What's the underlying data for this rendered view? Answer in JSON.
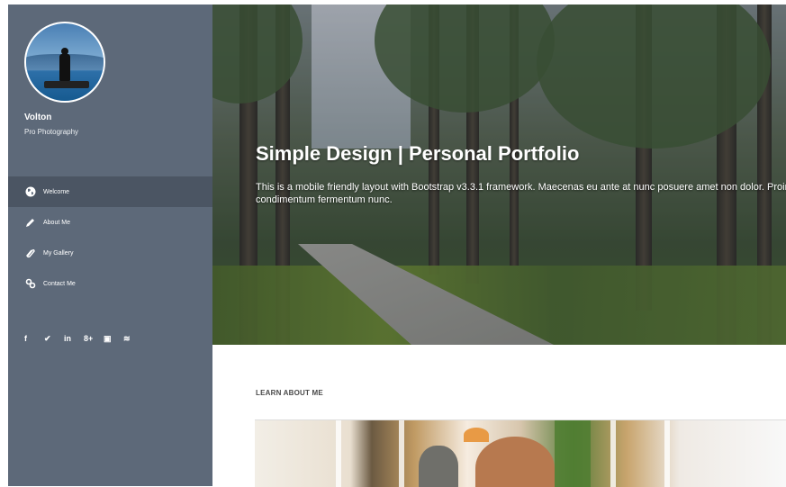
{
  "sidebar": {
    "brand_name": "Volton",
    "brand_tagline": "Pro Photography",
    "nav": [
      {
        "label": "Welcome",
        "icon": "globe-icon",
        "active": true
      },
      {
        "label": "About Me",
        "icon": "pencil-icon",
        "active": false
      },
      {
        "label": "My Gallery",
        "icon": "paperclip-icon",
        "active": false
      },
      {
        "label": "Contact Me",
        "icon": "link-icon",
        "active": false
      }
    ],
    "social": [
      {
        "icon": "facebook-icon",
        "glyph": "f"
      },
      {
        "icon": "twitter-icon",
        "glyph": "✔"
      },
      {
        "icon": "linkedin-icon",
        "glyph": "in"
      },
      {
        "icon": "google-plus-icon",
        "glyph": "8+"
      },
      {
        "icon": "youtube-icon",
        "glyph": "▣"
      },
      {
        "icon": "rss-icon",
        "glyph": "≋"
      }
    ]
  },
  "hero": {
    "title": "Simple Design | Personal Portfolio",
    "description": "This is a mobile friendly layout with Bootstrap v3.3.1 framework. Maecenas eu ante at nunc posuere amet non dolor. Proin condimentum fermentum nunc."
  },
  "learn": {
    "title": "LEARN ABOUT ME"
  },
  "colors": {
    "sidebar": "#5d6979",
    "sidebar_active": "#4b5563",
    "text_light": "#ffffff"
  }
}
